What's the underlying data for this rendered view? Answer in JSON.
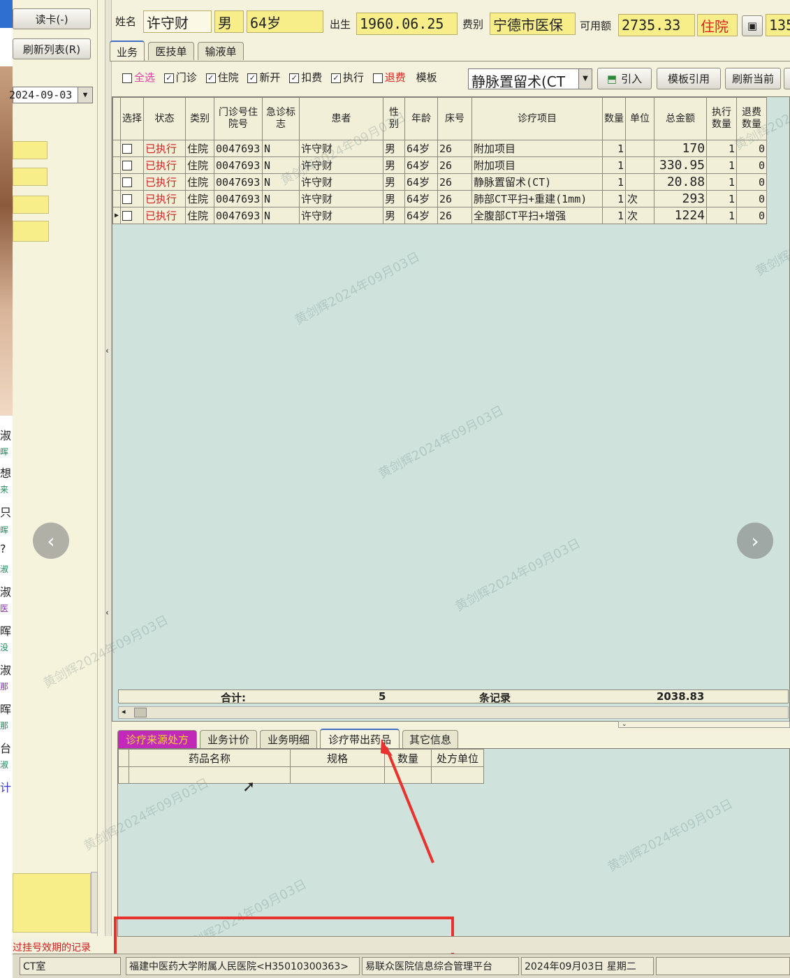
{
  "left_panel": {
    "read_card": "读卡(-)",
    "refresh_list": "刷新列表(R)",
    "date": "2024-09-03",
    "expired_notice": "过挂号效期的记录",
    "ct_room": "CT室"
  },
  "chat_chars": [
    "淑",
    "晖",
    "想",
    "来",
    "只",
    "晖",
    "?",
    "淑",
    "淑",
    "医",
    "晖",
    "没",
    "淑",
    "那",
    "晖",
    "那",
    "台",
    "淑",
    "计"
  ],
  "patient": {
    "name_label": "姓名",
    "name": "许守财",
    "gender": "男",
    "age": "64岁",
    "birth_label": "出生",
    "birth": "1960.06.25",
    "fee_type_label": "费别",
    "fee_type": "宁德市医保",
    "balance_label": "可用额",
    "balance": "2735.33",
    "status": "住院",
    "extra": "135"
  },
  "tabs": [
    "业务",
    "医技单",
    "输液单"
  ],
  "filters": {
    "select_all": "全选",
    "outpatient": "门诊",
    "inpatient": "住院",
    "new_open": "新开",
    "deduct": "扣费",
    "execute": "执行",
    "refund": "退费",
    "template_label": "模板",
    "template_value": "静脉置留术(CT",
    "import_btn": "引入",
    "template_ref_btn": "模板引用",
    "refresh_btn": "刷新当前"
  },
  "table": {
    "headers": [
      "选择",
      "状态",
      "类别",
      "门诊号住院号",
      "急诊标志",
      "患者",
      "性别",
      "年龄",
      "床号",
      "诊疗项目",
      "数量",
      "单位",
      "总金额",
      "执行数量",
      "退费数量"
    ],
    "rows": [
      {
        "status": "已执行",
        "type": "住院",
        "id": "0047693",
        "urgent": "N",
        "patient": "许守财",
        "gender": "男",
        "age": "64岁",
        "bed": "26",
        "item": "附加项目",
        "qty": "1",
        "unit": "",
        "amount": "170",
        "exec": "1",
        "refund": "0"
      },
      {
        "status": "已执行",
        "type": "住院",
        "id": "0047693",
        "urgent": "N",
        "patient": "许守财",
        "gender": "男",
        "age": "64岁",
        "bed": "26",
        "item": "附加项目",
        "qty": "1",
        "unit": "",
        "amount": "330.95",
        "exec": "1",
        "refund": "0"
      },
      {
        "status": "已执行",
        "type": "住院",
        "id": "0047693",
        "urgent": "N",
        "patient": "许守财",
        "gender": "男",
        "age": "64岁",
        "bed": "26",
        "item": "静脉置留术(CT)",
        "qty": "1",
        "unit": "",
        "amount": "20.88",
        "exec": "1",
        "refund": "0"
      },
      {
        "status": "已执行",
        "type": "住院",
        "id": "0047693",
        "urgent": "N",
        "patient": "许守财",
        "gender": "男",
        "age": "64岁",
        "bed": "26",
        "item": "肺部CT平扫+重建(1mm)",
        "qty": "1",
        "unit": "次",
        "amount": "293",
        "exec": "1",
        "refund": "0"
      },
      {
        "status": "已执行",
        "type": "住院",
        "id": "0047693",
        "urgent": "N",
        "patient": "许守财",
        "gender": "男",
        "age": "64岁",
        "bed": "26",
        "item": "全腹部CT平扫+增强",
        "qty": "1",
        "unit": "次",
        "amount": "1224",
        "exec": "1",
        "refund": "0"
      }
    ],
    "total_label": "合计:",
    "total_count": "5",
    "records_label": "条记录",
    "total_amount": "2038.83"
  },
  "watermark": "黄剑辉2024年09月03日",
  "bottom_tabs": [
    "诊疗来源处方",
    "业务计价",
    "业务明细",
    "诊疗带出药品",
    "其它信息"
  ],
  "drug_table": {
    "headers": [
      "药品名称",
      "规格",
      "数量",
      "处方单位"
    ]
  },
  "footer": {
    "hospital": "福建中医药大学附属人民医院<H35010300363>",
    "platform": "易联众医院信息综合管理平台",
    "date": "2024年09月03日 星期二"
  },
  "colors": {
    "highlight_red": "#e8322d",
    "field_yellow": "#f7ee8a",
    "grid_bg": "#cfe3dc",
    "status_red": "#d21e1e"
  }
}
